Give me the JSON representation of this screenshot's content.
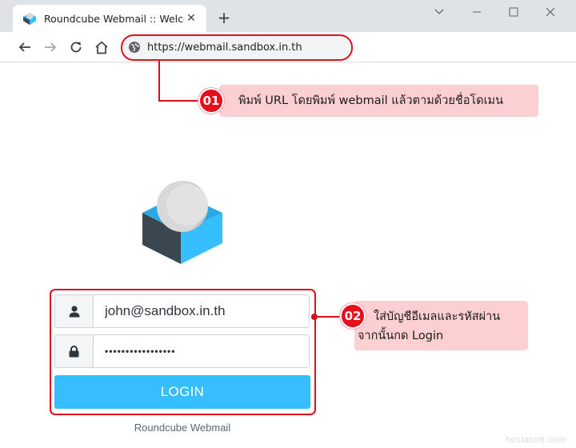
{
  "browser": {
    "tab_title": "Roundcube Webmail :: Welcome",
    "tab_close": "✕",
    "new_tab": "+",
    "url": "https://webmail.sandbox.in.th"
  },
  "annotations": {
    "step1": {
      "number": "01",
      "text": "พิมพ์ URL โดยพิมพ์ webmail แล้วตามด้วยชื่อโดเมน"
    },
    "step2": {
      "number": "02",
      "text_line1": "ใส่บัญชีอีเมลและรหัสผ่าน",
      "text_line2": "จากนั้นกด Login"
    },
    "highlight_color": "#e0101e",
    "note_background": "#fccfd2"
  },
  "login": {
    "username_value": "john@sandbox.in.th",
    "password_value": "•••••••••••••••••",
    "button_label": "LOGIN",
    "footer": "Roundcube Webmail",
    "button_color": "#37beff"
  },
  "watermark": "hostatom.com",
  "icons": {
    "tab_favicon": "roundcube-logo-icon",
    "back": "arrow-left-icon",
    "forward": "arrow-right-icon",
    "reload": "reload-icon",
    "home": "home-icon",
    "site_info": "globe-icon",
    "user_field": "user-icon",
    "password_field": "lock-icon"
  }
}
